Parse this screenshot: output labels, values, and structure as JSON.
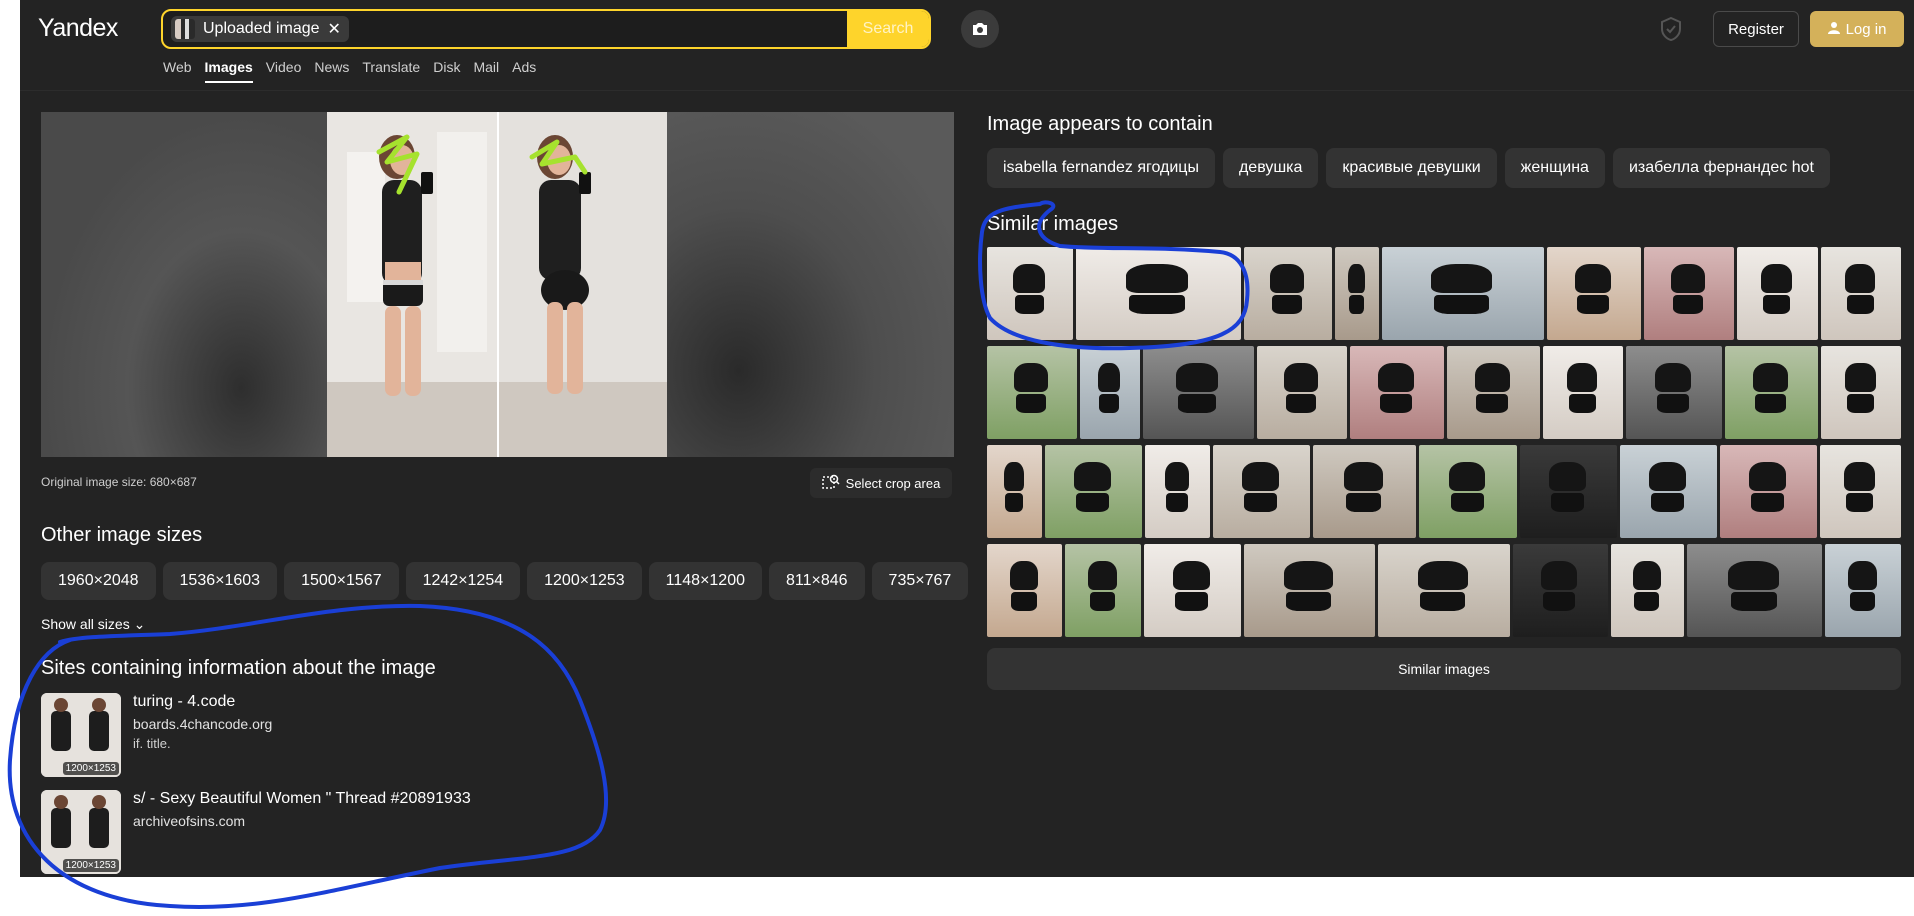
{
  "header": {
    "logo": "Yandex",
    "search_chip": "Uploaded image",
    "search_button": "Search",
    "register": "Register",
    "login": "Log in"
  },
  "services": [
    "Web",
    "Images",
    "Video",
    "News",
    "Translate",
    "Disk",
    "Mail",
    "Ads"
  ],
  "preview": {
    "original_size": "Original image size: 680×687",
    "crop_button": "Select crop area"
  },
  "other_sizes": {
    "title": "Other image sizes",
    "sizes": [
      "1960×2048",
      "1536×1603",
      "1500×1567",
      "1242×1254",
      "1200×1253",
      "1148×1200",
      "811×846",
      "735×767"
    ],
    "show_all": "Show all sizes"
  },
  "sites": {
    "title": "Sites containing information about the image",
    "items": [
      {
        "title": "turing - 4.code",
        "domain": "boards.4chancode.org",
        "snippet": "if. title.",
        "badge": "1200×1253"
      },
      {
        "title": "s/ - Sexy Beautiful Women \" Thread #20891933",
        "domain": "archiveofsins.com",
        "snippet": "",
        "badge": "1200×1253"
      }
    ]
  },
  "contains": {
    "title": "Image appears to contain",
    "tags": [
      "isabella fernandez ягодицы",
      "девушка",
      "красивые девушки",
      "женщина",
      "изабелла фернандес hot"
    ]
  },
  "similar": {
    "title": "Similar images",
    "button": "Similar images"
  },
  "colors": {
    "accent": "#fed42b",
    "background": "#232323",
    "annotation_blue": "#1a3fd6",
    "scribble_green": "#a6e22e"
  }
}
